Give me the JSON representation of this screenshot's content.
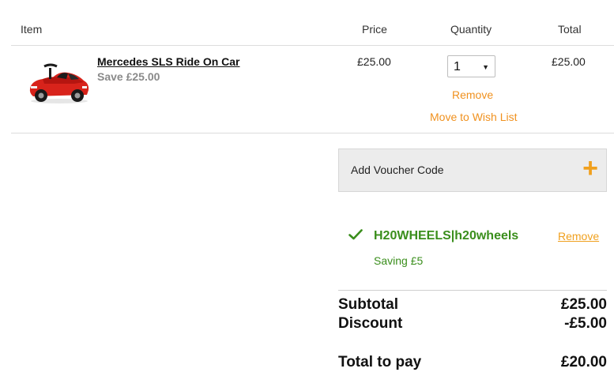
{
  "table": {
    "headers": {
      "item": "Item",
      "price": "Price",
      "quantity": "Quantity",
      "total": "Total"
    }
  },
  "product": {
    "name": "Mercedes SLS Ride On Car",
    "save": "Save £25.00",
    "price": "£25.00",
    "quantity": "1",
    "total": "£25.00",
    "remove_label": "Remove",
    "wishlist_label": "Move to Wish List",
    "image_icon": "red-toy-car"
  },
  "voucher": {
    "add_label": "Add Voucher Code",
    "expand_icon": "plus-icon",
    "applied_code": "H20WHEELS|h20wheels",
    "remove_label": "Remove",
    "saving_text": "Saving £5",
    "check_icon": "checkmark-icon"
  },
  "summary": {
    "subtotal_label": "Subtotal",
    "subtotal_value": "£25.00",
    "discount_label": "Discount",
    "discount_value": "-£5.00",
    "total_label": "Total to pay",
    "total_value": "£20.00"
  },
  "colors": {
    "link_orange": "#f0911e",
    "success_green": "#3a8e1c",
    "plus_orange": "#f0a01e"
  }
}
